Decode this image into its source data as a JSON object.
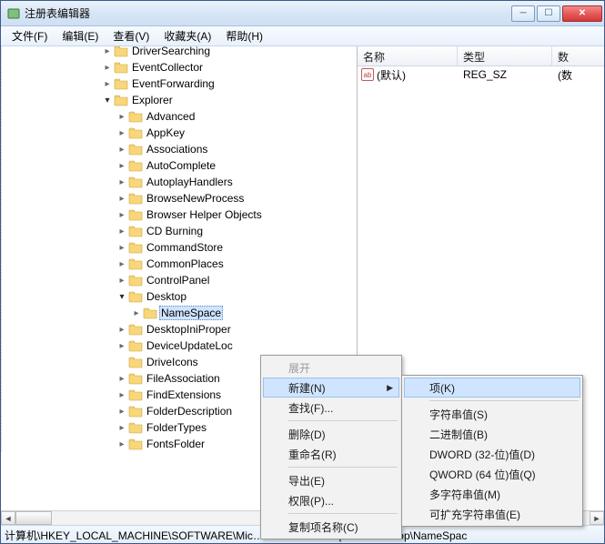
{
  "window": {
    "title": "注册表编辑器"
  },
  "menu": {
    "file": "文件(F)",
    "edit": "编辑(E)",
    "view": "查看(V)",
    "fav": "收藏夹(A)",
    "help": "帮助(H)"
  },
  "tree": [
    {
      "lvl": 7,
      "exp": "closed",
      "label": "DriverSearching"
    },
    {
      "lvl": 7,
      "exp": "closed",
      "label": "EventCollector"
    },
    {
      "lvl": 7,
      "exp": "closed",
      "label": "EventForwarding"
    },
    {
      "lvl": 7,
      "exp": "open",
      "label": "Explorer"
    },
    {
      "lvl": 8,
      "exp": "closed",
      "label": "Advanced"
    },
    {
      "lvl": 8,
      "exp": "closed",
      "label": "AppKey"
    },
    {
      "lvl": 8,
      "exp": "closed",
      "label": "Associations"
    },
    {
      "lvl": 8,
      "exp": "closed",
      "label": "AutoComplete"
    },
    {
      "lvl": 8,
      "exp": "closed",
      "label": "AutoplayHandlers"
    },
    {
      "lvl": 8,
      "exp": "closed",
      "label": "BrowseNewProcess"
    },
    {
      "lvl": 8,
      "exp": "closed",
      "label": "Browser Helper Objects"
    },
    {
      "lvl": 8,
      "exp": "closed",
      "label": "CD Burning"
    },
    {
      "lvl": 8,
      "exp": "closed",
      "label": "CommandStore"
    },
    {
      "lvl": 8,
      "exp": "closed",
      "label": "CommonPlaces"
    },
    {
      "lvl": 8,
      "exp": "closed",
      "label": "ControlPanel"
    },
    {
      "lvl": 8,
      "exp": "open",
      "label": "Desktop"
    },
    {
      "lvl": 9,
      "exp": "closed",
      "label": "NameSpace",
      "sel": true
    },
    {
      "lvl": 8,
      "exp": "closed",
      "label": "DesktopIniProper"
    },
    {
      "lvl": 8,
      "exp": "closed",
      "label": "DeviceUpdateLoc"
    },
    {
      "lvl": 8,
      "exp": "none",
      "label": "DriveIcons"
    },
    {
      "lvl": 8,
      "exp": "closed",
      "label": "FileAssociation"
    },
    {
      "lvl": 8,
      "exp": "closed",
      "label": "FindExtensions"
    },
    {
      "lvl": 8,
      "exp": "closed",
      "label": "FolderDescription"
    },
    {
      "lvl": 8,
      "exp": "closed",
      "label": "FolderTypes"
    },
    {
      "lvl": 8,
      "exp": "closed",
      "label": "FontsFolder"
    }
  ],
  "list": {
    "cols": {
      "name": "名称",
      "type": "类型",
      "data": "数"
    },
    "rows": [
      {
        "name": "(默认)",
        "type": "REG_SZ",
        "data": "(数"
      }
    ]
  },
  "ctx1": {
    "expand": "展开",
    "new": "新建(N)",
    "find": "查找(F)...",
    "del": "删除(D)",
    "ren": "重命名(R)",
    "exp": "导出(E)",
    "perm": "权限(P)...",
    "copy": "复制项名称(C)"
  },
  "ctx2": {
    "key": "项(K)",
    "str": "字符串值(S)",
    "bin": "二进制值(B)",
    "dw": "DWORD (32-位)值(D)",
    "qw": "QWORD (64 位)值(Q)",
    "ms": "多字符串值(M)",
    "es": "可扩充字符串值(E)"
  },
  "status": "计算机\\HKEY_LOCAL_MACHINE\\SOFTWARE\\Mic……\\……rsion\\Explorer\\Desktop\\NameSpac",
  "icons": {
    "ab": "ab"
  }
}
